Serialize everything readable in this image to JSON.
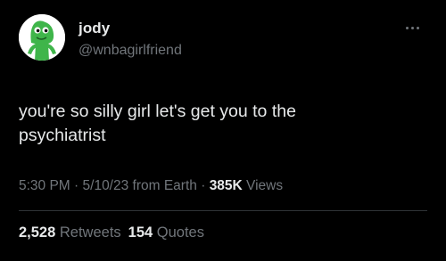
{
  "tweet": {
    "author": {
      "display_name": "jody",
      "handle": "@wnbagirlfriend",
      "avatar_icon": "gumby-icon"
    },
    "more_icon": "more-options-icon",
    "text_line1": "you're so silly girl let's get you to the",
    "text_line2": "psychiatrist",
    "meta": {
      "time": "5:30 PM",
      "sep1": " · ",
      "date": "5/10/23",
      "source": " from Earth",
      "sep2": " · ",
      "views_count": "385K",
      "views_label": " Views"
    },
    "stats": {
      "retweets_count": "2,528",
      "retweets_label": " Retweets",
      "quotes_count": "154",
      "quotes_label": " Quotes"
    }
  },
  "colors": {
    "background": "#000000",
    "primary_text": "#e7e9ea",
    "secondary_text": "#71767b",
    "divider": "#2f3336",
    "avatar_green": "#3fb54a"
  }
}
